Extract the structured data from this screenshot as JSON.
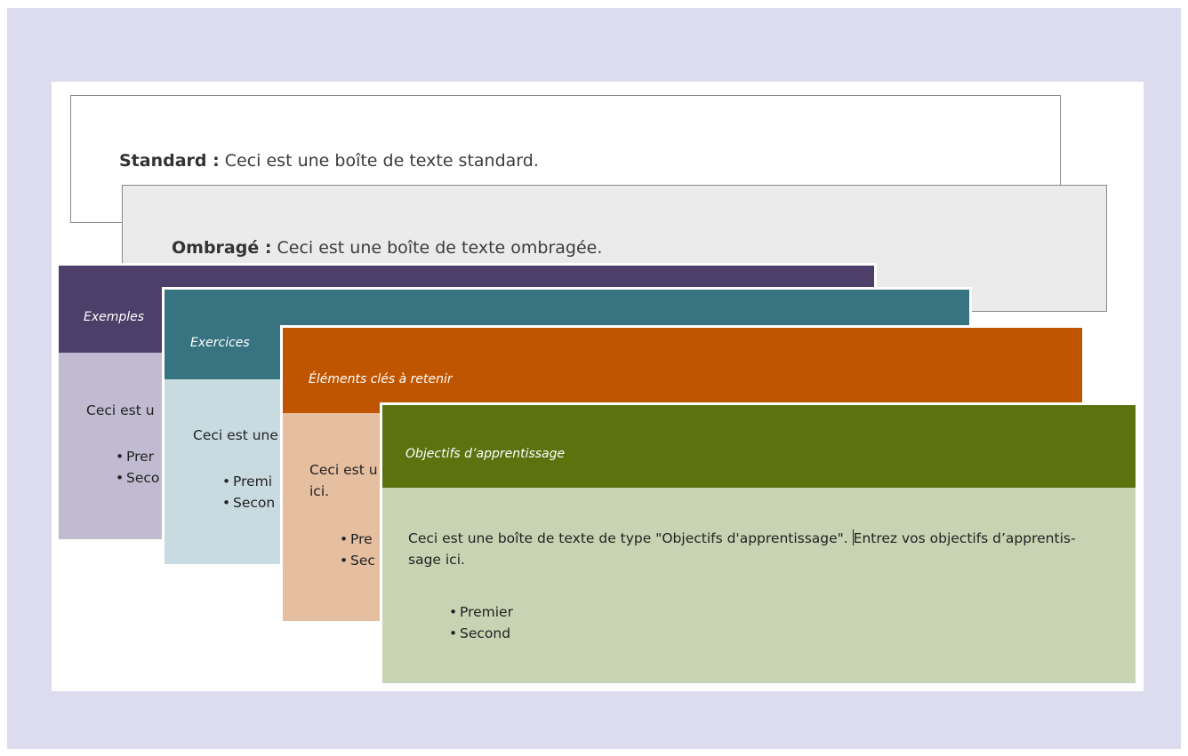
{
  "standard": {
    "label": "Standard :",
    "text": " Ceci est une boîte de texte standard."
  },
  "ombrage": {
    "label": "Ombragé :",
    "text": " Ceci est une boîte de texte ombragée."
  },
  "cards": {
    "exemples": {
      "title": "Exemples",
      "text": "Ceci est u",
      "items": [
        "Prer",
        "Seco"
      ],
      "header_color": "#4d3f6a",
      "body_color": "#c0bbd1"
    },
    "exercices": {
      "title": "Exercices",
      "text": "Ceci est une",
      "items": [
        "Premi",
        "Secon"
      ],
      "header_color": "#377381",
      "body_color": "#c8dbe1"
    },
    "elements": {
      "title": "Éléments clés à retenir",
      "text_line1": "Ceci est u",
      "text_line2": "ici.",
      "items": [
        "Pre",
        "Sec"
      ],
      "header_color": "#bf5500",
      "body_color": "#e6bea0"
    },
    "objectifs": {
      "title": "Objectifs d’apprentissage",
      "text_line1a": "Ceci est une boîte de texte de type \"Objectifs d'apprentissage\". ",
      "text_line1b": "Entrez vos objectifs d’apprentis-",
      "text_line2": "sage ici.",
      "items": [
        "Premier",
        "Second"
      ],
      "header_color": "#5a730f",
      "body_color": "#c8d3b3"
    }
  },
  "background_color": "#dddcee"
}
